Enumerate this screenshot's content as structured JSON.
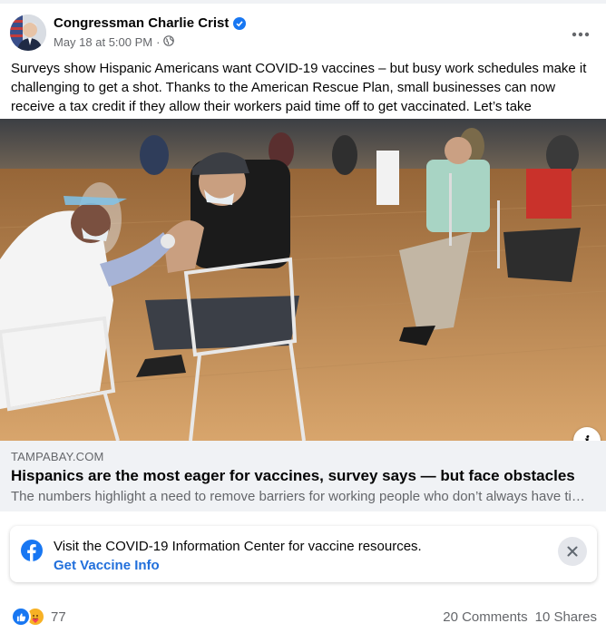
{
  "post": {
    "author": "Congressman Charlie Crist",
    "timestamp": "May 18 at 5:00 PM",
    "separator": "·",
    "audience_icon": "globe-icon",
    "verified_icon": "verified-badge-icon",
    "text": "Surveys show Hispanic Americans want COVID-19 vaccines – but busy work schedules make it challenging to get a shot. Thanks to the American Rescue Plan, small businesses can now receive a tax credit if they allow their workers paid time off to get vaccinated. Let’s take advantage!"
  },
  "link_preview": {
    "domain": "TAMPABAY.COM",
    "title": "Hispanics are the most eager for vaccines, survey says — but face obstacles",
    "description": "The numbers highlight a need to remove barriers for working people who don’t always have time off to get vaccinated."
  },
  "covid_banner": {
    "text": "Visit the COVID-19 Information Center for vaccine resources.",
    "link": "Get Vaccine Info"
  },
  "footer": {
    "reaction_count": "77",
    "comments": "20 Comments",
    "shares": "10 Shares"
  },
  "colors": {
    "facebook_blue": "#1877f2",
    "link_blue": "#216fdb",
    "secondary_text": "#65676b",
    "preview_bg": "#f0f2f5"
  }
}
